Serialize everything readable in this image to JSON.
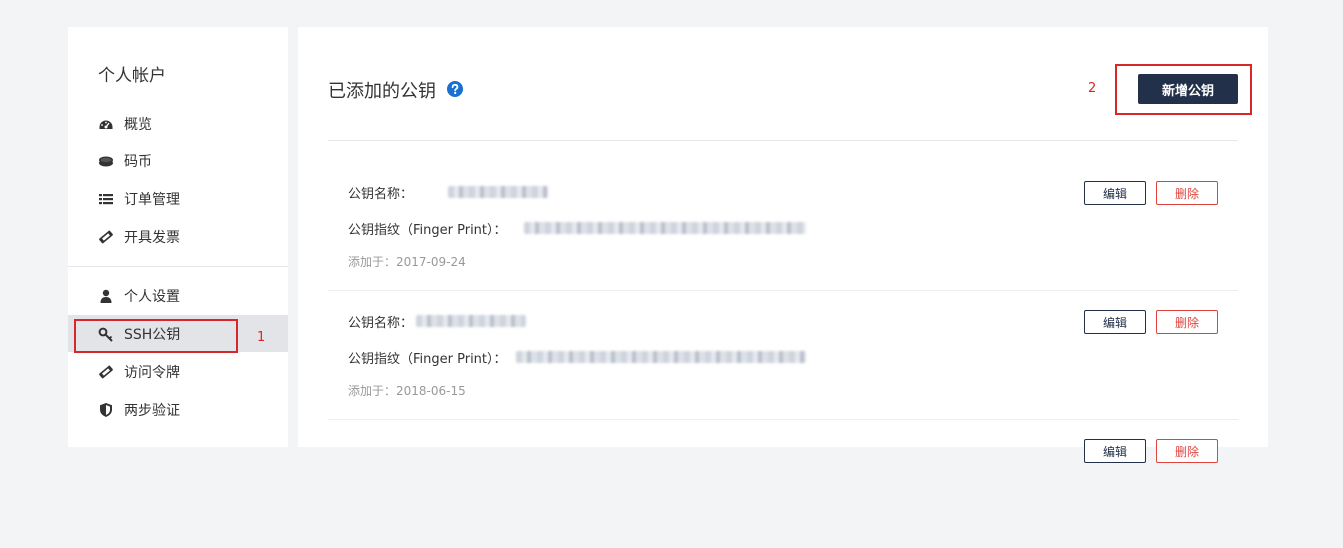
{
  "sidebar": {
    "title": "个人帐户",
    "group1": [
      {
        "label": "概览",
        "icon": "dashboard-icon"
      },
      {
        "label": "码币",
        "icon": "coins-icon"
      },
      {
        "label": "订单管理",
        "icon": "list-icon"
      },
      {
        "label": "开具发票",
        "icon": "ticket-icon"
      }
    ],
    "group2": [
      {
        "label": "个人设置",
        "icon": "user-icon"
      },
      {
        "label": "SSH公钥",
        "icon": "key-icon",
        "active": true
      },
      {
        "label": "访问令牌",
        "icon": "ticket-icon"
      },
      {
        "label": "两步验证",
        "icon": "shield-icon"
      }
    ]
  },
  "main": {
    "title": "已添加的公钥",
    "help_icon": "question-circle-icon",
    "add_button": "新增公钥",
    "keys": [
      {
        "name_label": "公钥名称：",
        "fingerprint_label": "公钥指纹（Finger Print）：",
        "added": "添加于：2017-09-24",
        "edit": "编辑",
        "delete": "删除"
      },
      {
        "name_label": "公钥名称：",
        "fingerprint_label": "公钥指纹（Finger Print）：",
        "added": "添加于：2018-06-15",
        "edit": "编辑",
        "delete": "删除"
      },
      {
        "edit": "编辑",
        "delete": "删除"
      }
    ]
  },
  "annotations": {
    "one": "1",
    "two": "2"
  },
  "colors": {
    "primary_button": "#22304a",
    "delete": "#e0443e",
    "annotation": "#d6272b",
    "help_icon": "#1a6fd1"
  }
}
